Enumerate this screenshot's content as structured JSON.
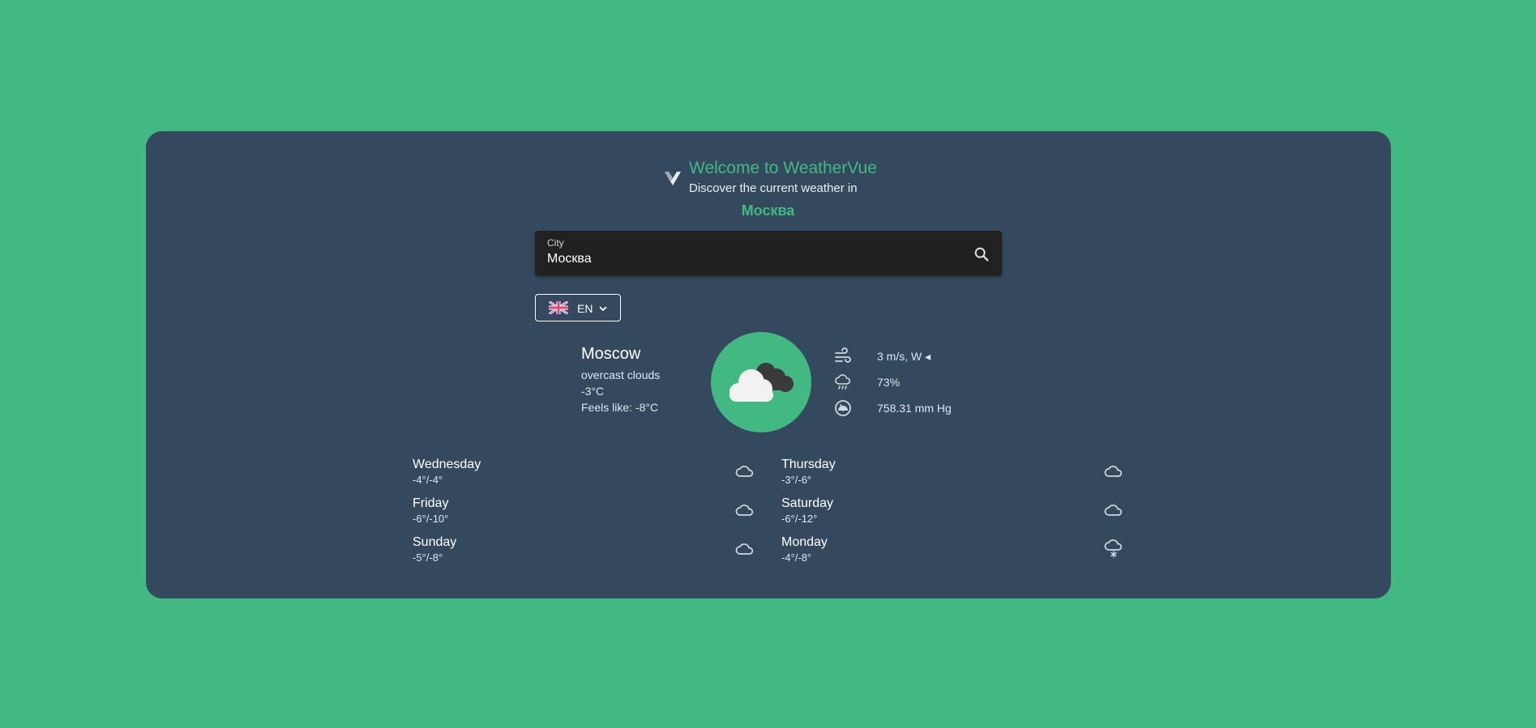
{
  "header": {
    "title": "Welcome to WeatherVue",
    "subtitle": "Discover the current weather in",
    "city_native": "Москва"
  },
  "search": {
    "label": "City",
    "value": "Москва"
  },
  "language": {
    "code": "EN"
  },
  "current": {
    "city": "Moscow",
    "description": "overcast clouds",
    "temperature": "-3°C",
    "feels_like": "Feels like: -8°C",
    "icon": "cloud-icon",
    "wind": "3 m/s, W ◂",
    "humidity": "73%",
    "pressure": "758.31 mm Hg"
  },
  "forecast": [
    {
      "day": "Wednesday",
      "temps": "-4°/-4°",
      "icon": "cloud-icon"
    },
    {
      "day": "Thursday",
      "temps": "-3°/-6°",
      "icon": "cloud-icon"
    },
    {
      "day": "Friday",
      "temps": "-6°/-10°",
      "icon": "cloud-icon"
    },
    {
      "day": "Saturday",
      "temps": "-6°/-12°",
      "icon": "cloud-icon"
    },
    {
      "day": "Sunday",
      "temps": "-5°/-8°",
      "icon": "cloud-icon"
    },
    {
      "day": "Monday",
      "temps": "-4°/-8°",
      "icon": "snow-cloud-icon"
    }
  ],
  "colors": {
    "background": "#42b883",
    "card": "#35495e",
    "accent": "#42b883"
  }
}
